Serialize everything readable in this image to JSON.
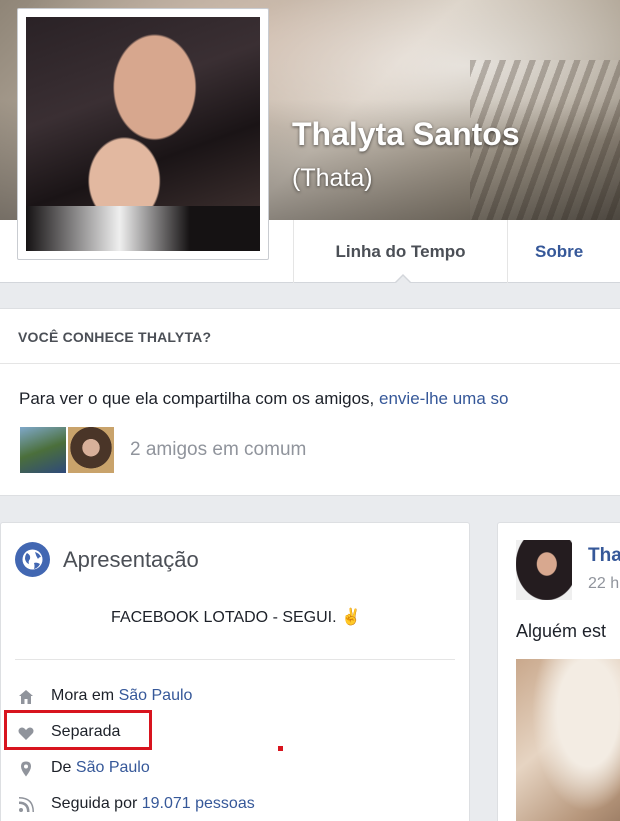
{
  "profile": {
    "name": "Thalyta Santos",
    "nickname": "(Thata)"
  },
  "tabs": [
    {
      "label": "Linha do Tempo"
    },
    {
      "label": "Sobre"
    }
  ],
  "know_card": {
    "title": "VOCÊ CONHECE THALYTA?",
    "text": "Para ver o que ela compartilha com os amigos, ",
    "link": "envie-lhe uma so",
    "mutual": "2 amigos em comum"
  },
  "intro": {
    "title": "Apresentação",
    "bio": "FACEBOOK LOTADO - SEGUI. ✌",
    "rows": [
      {
        "icon": "home-icon",
        "prefix": "Mora em ",
        "link": "São Paulo"
      },
      {
        "icon": "heart-icon",
        "prefix": "Separada",
        "link": ""
      },
      {
        "icon": "pin-icon",
        "prefix": "De ",
        "link": "São Paulo"
      },
      {
        "icon": "rss-icon",
        "prefix": "Seguida por ",
        "link": "19.071 pessoas"
      }
    ]
  },
  "post": {
    "author": "Tha",
    "time": "22 h",
    "text": "Alguém est"
  },
  "colors": {
    "fb_blue": "#365899",
    "highlight_red": "#d8141e",
    "page_bg": "#e9ebee"
  }
}
